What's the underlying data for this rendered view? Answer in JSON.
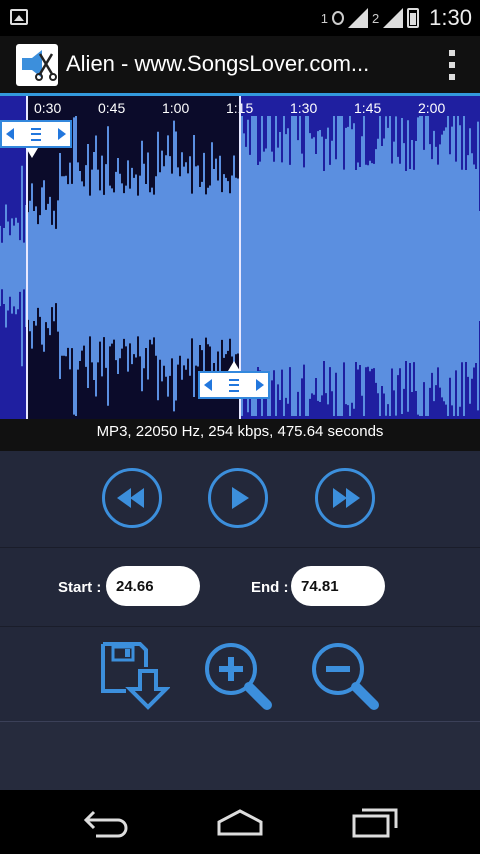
{
  "status_bar": {
    "sim1": "1",
    "sim2": "2",
    "time": "1:30",
    "icons": [
      "image-notification-icon",
      "data-transfer-icon",
      "signal-icon",
      "battery-icon"
    ]
  },
  "action_bar": {
    "title": "Alien - www.SongsLover.com...",
    "app_icon": "ringtone-cutter-app-icon",
    "menu_icon": "overflow-menu-icon"
  },
  "waveform": {
    "time_labels": [
      "0:30",
      "0:45",
      "1:00",
      "1:15",
      "1:30",
      "1:45",
      "2:00"
    ],
    "selection_color": "#0b0b2a",
    "background_color": "#1f1fa0",
    "wave_color": "#5b8fe0"
  },
  "file_info": "MP3, 22050 Hz, 254 kbps, 475.64 seconds",
  "playback": {
    "rewind_icon": "rewind-icon",
    "play_icon": "play-icon",
    "forward_icon": "fast-forward-icon"
  },
  "range": {
    "start_label": "Start :",
    "start_value": "24.66",
    "end_label": "End :",
    "end_value": "74.81"
  },
  "tools": {
    "save_icon": "save-icon",
    "zoom_in_icon": "zoom-in-icon",
    "zoom_out_icon": "zoom-out-icon"
  },
  "accent": "#3c8fdc"
}
